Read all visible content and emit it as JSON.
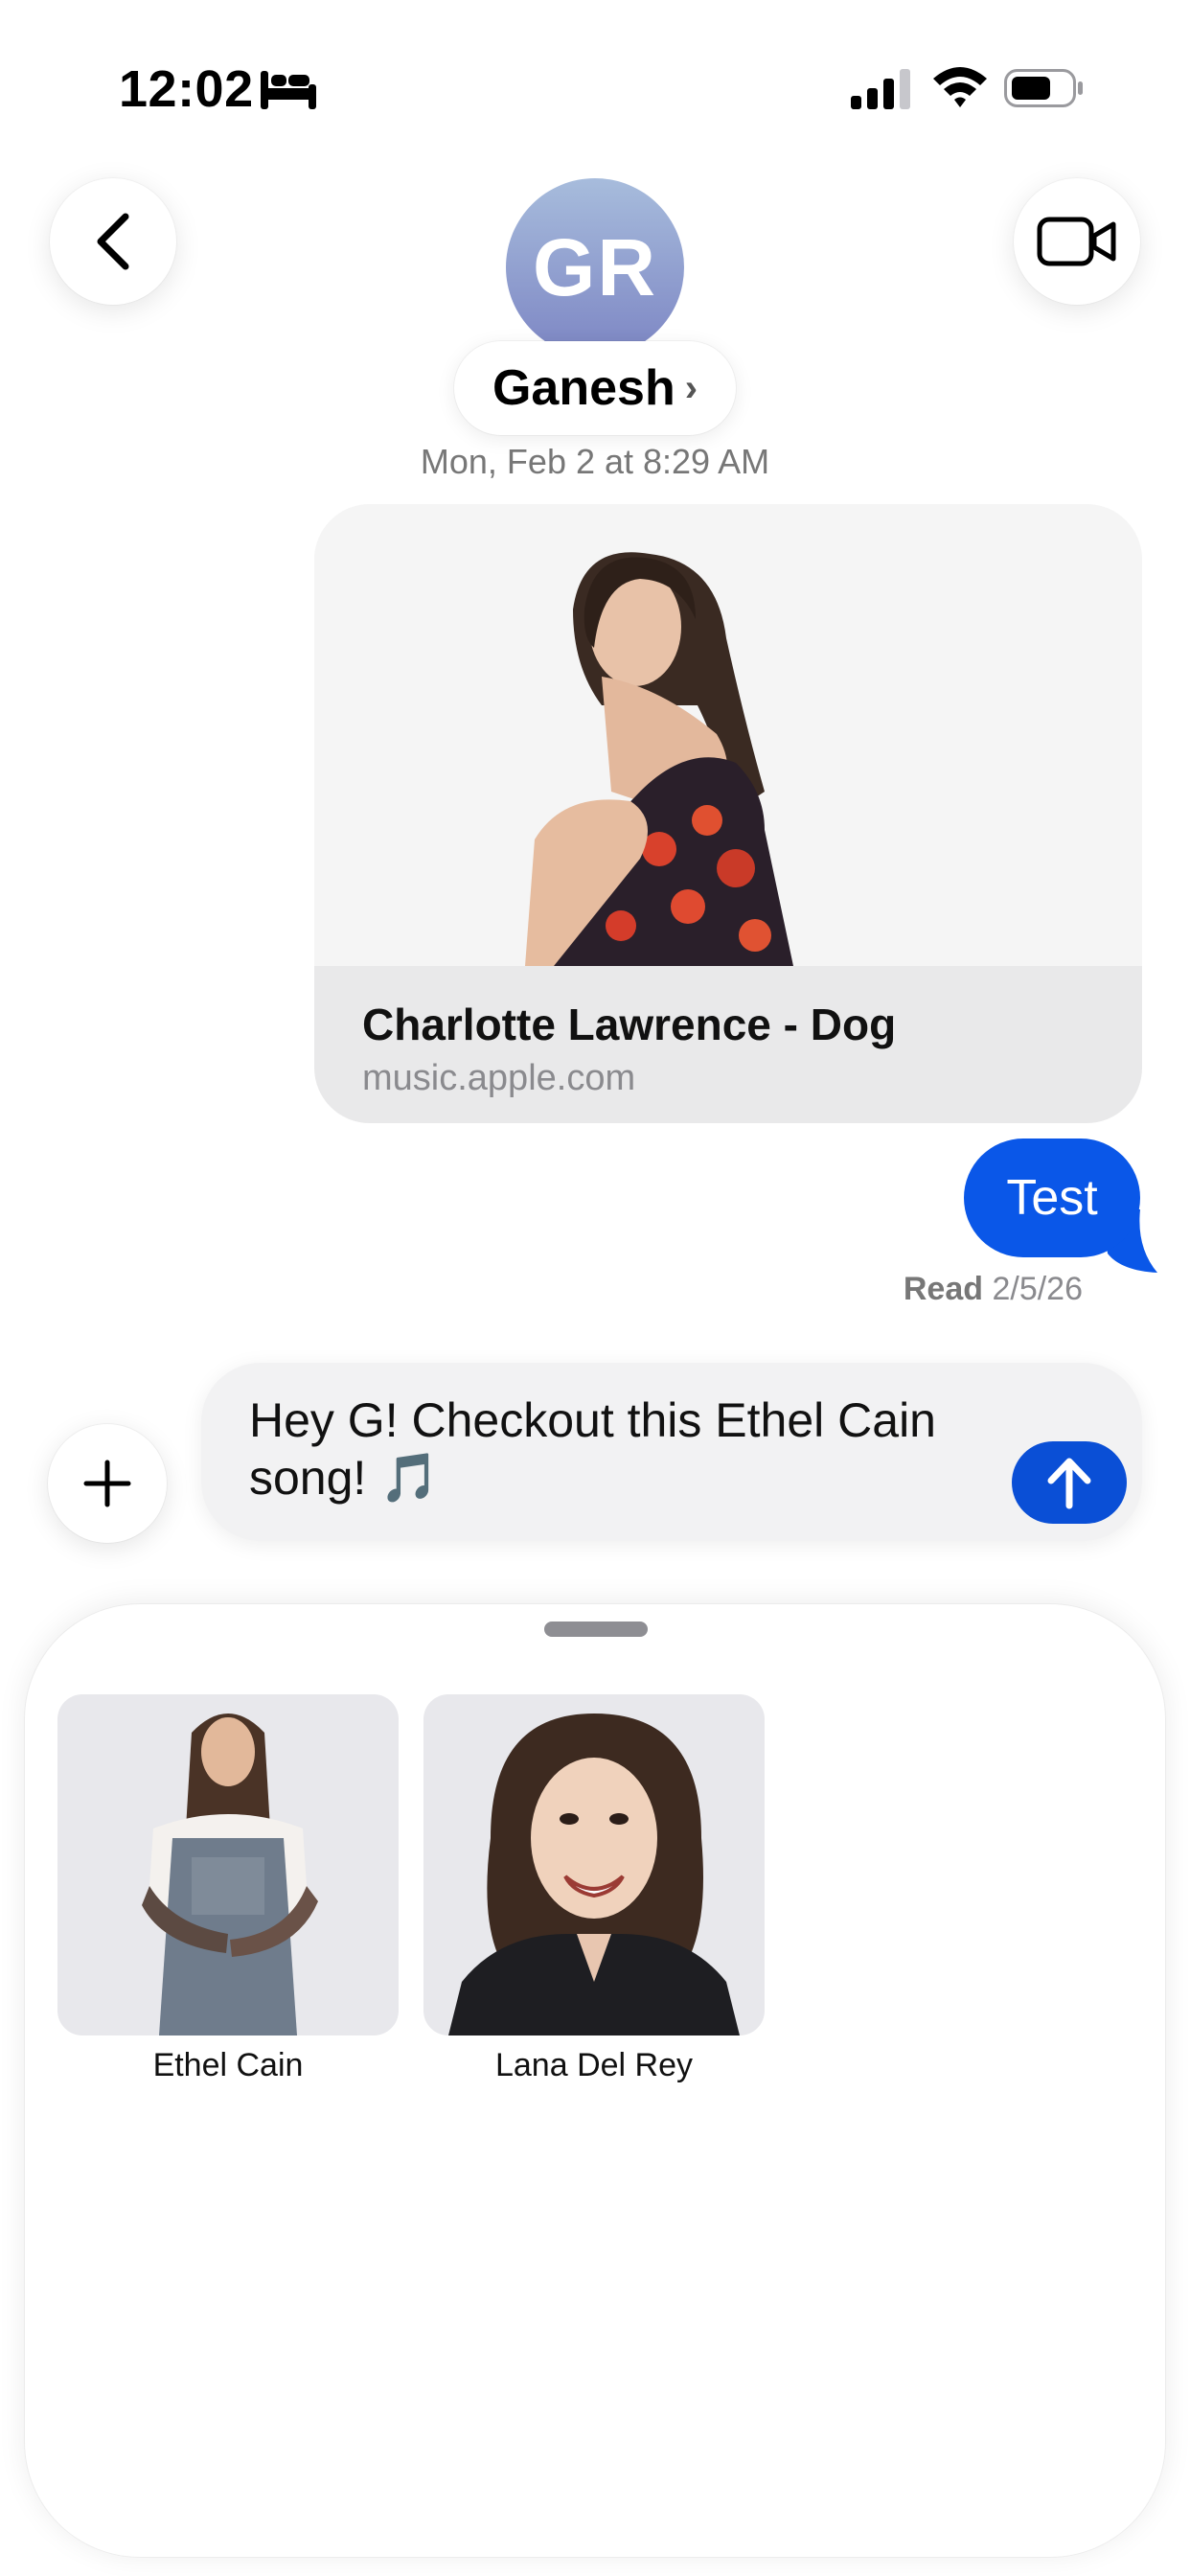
{
  "status_bar": {
    "time": "12:02",
    "icons": [
      "bed-icon",
      "cellular-signal-icon",
      "wifi-icon",
      "battery-icon"
    ]
  },
  "header": {
    "back_icon": "chevron-left-icon",
    "avatar_initials": "GR",
    "contact_name": "Ganesh",
    "contact_chevron": "›",
    "video_icon": "video-camera-icon"
  },
  "conversation": {
    "timestamp": "Mon, Feb 2 at 8:29 AM",
    "link_preview": {
      "title": "Charlotte Lawrence - Dog",
      "domain": "music.apple.com"
    },
    "sent_message": "Test",
    "read_label": "Read",
    "read_date": "2/5/26"
  },
  "composer": {
    "plus_icon": "plus-icon",
    "text": "Hey G! Checkout this Ethel Cain song! 🎵",
    "send_icon": "arrow-up-icon"
  },
  "suggestions": {
    "artists": [
      {
        "name": "Ethel Cain"
      },
      {
        "name": "Lana Del Rey"
      }
    ]
  },
  "colors": {
    "bubble_blue": "#0a57e8",
    "send_blue": "#0a4fd6",
    "avatar_gradient_top": "#a7bcdc",
    "avatar_gradient_bottom": "#7d86c4"
  }
}
